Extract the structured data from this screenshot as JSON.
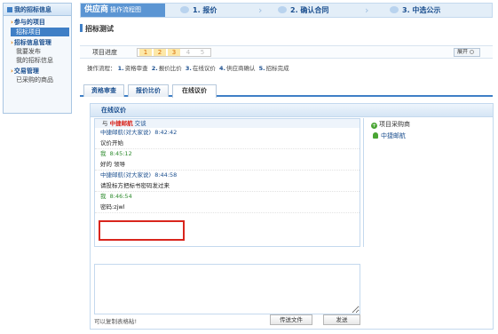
{
  "sidebar": {
    "header": "我的招标信息",
    "groups": [
      {
        "label": "参与的项目",
        "items": [
          {
            "label": "招标项目",
            "active": true
          }
        ]
      },
      {
        "label": "招标信息管理",
        "items": [
          {
            "label": "我要发布"
          },
          {
            "label": "我的招标信息"
          }
        ]
      },
      {
        "label": "交易管理",
        "items": [
          {
            "label": "已采购的商品"
          }
        ]
      }
    ]
  },
  "flow": {
    "brand": "供应商",
    "brand_sub": "操作流程图",
    "steps": [
      "1. 报价",
      "2. 确认合同",
      "3. 中选公示"
    ]
  },
  "page_title": "招标测试",
  "progress": {
    "label": "项目进度",
    "steps": [
      "1",
      "2",
      "3",
      "4",
      "5"
    ],
    "current": 3,
    "expand_label": "展开"
  },
  "process": {
    "label": "操作流程：",
    "steps": [
      {
        "num": "1.",
        "text": "资格审查"
      },
      {
        "num": "2.",
        "text": "报价比价"
      },
      {
        "num": "3.",
        "text": "在线议价"
      },
      {
        "num": "4.",
        "text": "供应商确认"
      },
      {
        "num": "5.",
        "text": "招标完成"
      }
    ]
  },
  "tabs": [
    {
      "label": "资格审查",
      "active": false
    },
    {
      "label": "报价比价",
      "active": false
    },
    {
      "label": "在线议价",
      "active": true
    }
  ],
  "chat": {
    "title": "在线议价",
    "with_prefix": "与",
    "with_name": "中捷邮航",
    "with_suffix": "交谈",
    "messages": [
      {
        "sender": "中捷邮航(对大家说)",
        "time": "8:42:42",
        "text": "议价开始",
        "me": false
      },
      {
        "sender": "我",
        "time": "8:45:12",
        "text": "好的 领导",
        "me": true
      },
      {
        "sender": "中捷邮航(对大家说)",
        "time": "8:44:58",
        "text": "请投标方把标书密码发过来",
        "me": false
      },
      {
        "sender": "我",
        "time": "8:46:54",
        "text": "密码:zjwl",
        "me": true
      }
    ],
    "buyers_title": "项目采购商",
    "buyers": [
      "中捷邮航"
    ],
    "input_value": "",
    "hint": "可以复制表格粘!",
    "send_file_label": "传送文件",
    "send_label": "发送"
  },
  "colors": {
    "accent": "#3f7fc6",
    "highlight": "#d9251d",
    "me_green": "#2e8b2e"
  }
}
